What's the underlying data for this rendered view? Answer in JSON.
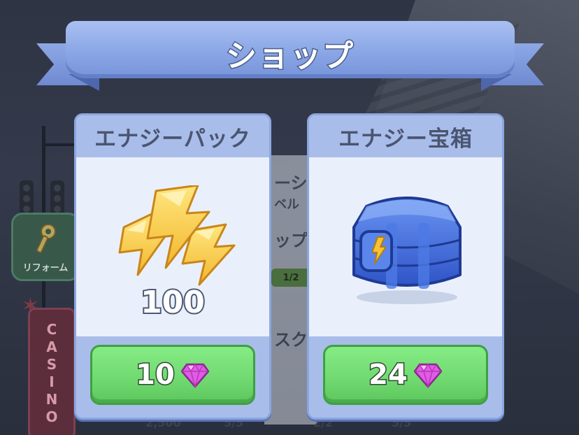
{
  "header": {
    "title": "ショップ"
  },
  "background": {
    "reform_label": "リフォーム",
    "casino_sign": "CASINO",
    "panel_fragments": [
      "ーシ",
      "ベル",
      "ップ",
      "スク"
    ],
    "progress": "1/2",
    "bottom_values": [
      "2,500",
      "5/5",
      "2/2",
      "5/5"
    ]
  },
  "items": [
    {
      "title": "エナジーパック",
      "amount": "100",
      "price": "10",
      "currency_icon": "gem-icon",
      "item_icon": "energy-bolts-icon"
    },
    {
      "title": "エナジー宝箱",
      "price": "24",
      "currency_icon": "gem-icon",
      "item_icon": "energy-chest-icon"
    }
  ],
  "colors": {
    "ribbon": "#8aa6e6",
    "card_header": "#a9bdea",
    "buy_button": "#6fd970",
    "gem": "#e25be6",
    "energy": "#f7c233",
    "chest": "#3f6fe0"
  }
}
